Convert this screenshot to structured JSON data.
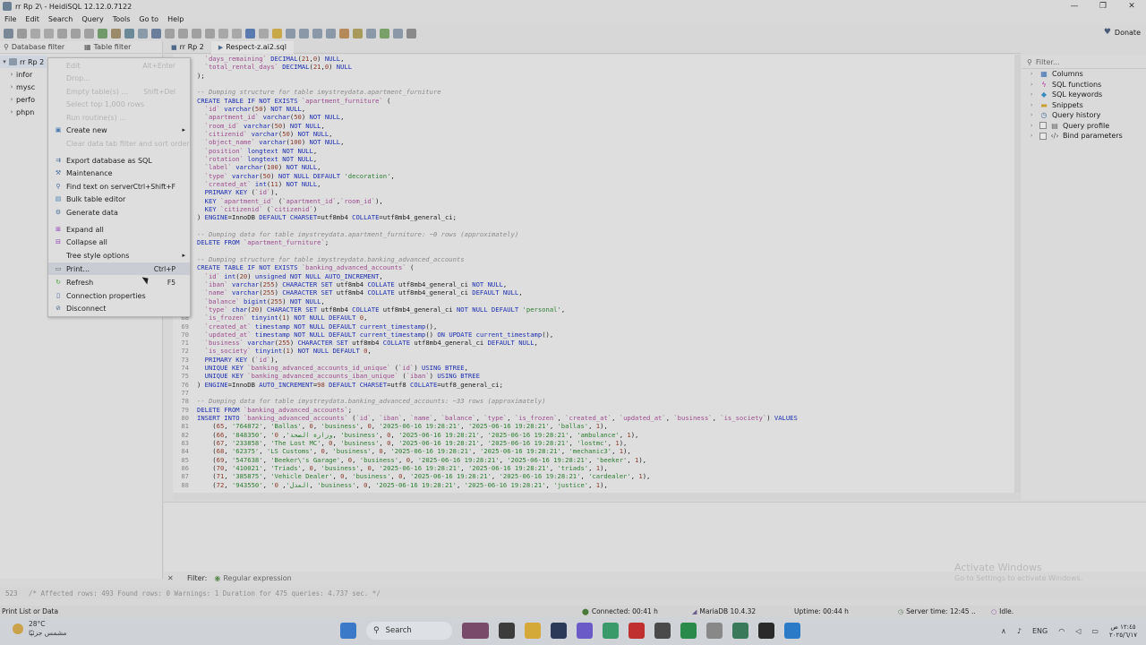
{
  "window": {
    "title": "rr Rp 2\\ - HeidiSQL 12.12.0.7122",
    "controls": [
      "—",
      "❐",
      "✕"
    ]
  },
  "menu": [
    "File",
    "Edit",
    "Search",
    "Query",
    "Tools",
    "Go to",
    "Help"
  ],
  "toolbar": {
    "donate": "Donate"
  },
  "left": {
    "database_filter": "Database filter",
    "table_filter": "Table filter",
    "tree": [
      {
        "label": "rr Rp 2",
        "root": true
      },
      {
        "label": "infor"
      },
      {
        "label": "mysc"
      },
      {
        "label": "perfo"
      },
      {
        "label": "phpn"
      }
    ]
  },
  "tabs": [
    {
      "label": "rr Rp 2"
    },
    {
      "label": "Respect-z.ai2.sql"
    }
  ],
  "context_menu": [
    {
      "label": "Edit",
      "shortcut": "Alt+Enter",
      "disabled": true
    },
    {
      "label": "Drop...",
      "shortcut": "",
      "disabled": true
    },
    {
      "label": "Empty table(s) ...",
      "shortcut": "Shift+Del",
      "disabled": true
    },
    {
      "label": "Select top 1,000 rows",
      "shortcut": "",
      "disabled": true
    },
    {
      "label": "Run routine(s) ...",
      "shortcut": "",
      "disabled": true
    },
    {
      "label": "Create new",
      "shortcut": "",
      "submenu": true
    },
    {
      "label": "Clear data tab filter and sort order",
      "shortcut": "",
      "disabled": true
    },
    {
      "label": "Export database as SQL",
      "shortcut": ""
    },
    {
      "label": "Maintenance",
      "shortcut": ""
    },
    {
      "label": "Find text on server",
      "shortcut": "Ctrl+Shift+F"
    },
    {
      "label": "Bulk table editor",
      "shortcut": ""
    },
    {
      "label": "Generate data",
      "shortcut": ""
    },
    {
      "label": "Expand all",
      "shortcut": ""
    },
    {
      "label": "Collapse all",
      "shortcut": ""
    },
    {
      "label": "Tree style options",
      "shortcut": "",
      "submenu": true
    },
    {
      "label": "Print...",
      "shortcut": "Ctrl+P",
      "hover": true
    },
    {
      "label": "Refresh",
      "shortcut": "F5"
    },
    {
      "label": "Connection properties",
      "shortcut": ""
    },
    {
      "label": "Disconnect",
      "shortcut": ""
    }
  ],
  "editor": {
    "lines": [
      {
        "n": "",
        "t": "  `days_remaining` DECIMAL(21,0) NULL,"
      },
      {
        "n": "",
        "t": "  `total_rental_days` DECIMAL(21,0) NULL"
      },
      {
        "n": "",
        "t": ");"
      },
      {
        "n": "",
        "t": ""
      },
      {
        "n": "",
        "t": "-- Dumping structure for table imystreydata.apartment_furniture"
      },
      {
        "n": "",
        "t": "CREATE TABLE IF NOT EXISTS `apartment_furniture` ("
      },
      {
        "n": "",
        "t": "  `id` varchar(50) NOT NULL,"
      },
      {
        "n": "",
        "t": "  `apartment_id` varchar(50) NOT NULL,"
      },
      {
        "n": "",
        "t": "  `room_id` varchar(50) NOT NULL,"
      },
      {
        "n": "",
        "t": "  `citizenid` varchar(50) NOT NULL,"
      },
      {
        "n": "",
        "t": "  `object_name` varchar(100) NOT NULL,"
      },
      {
        "n": "",
        "t": "  `position` longtext NOT NULL,"
      },
      {
        "n": "",
        "t": "  `rotation` longtext NOT NULL,"
      },
      {
        "n": "",
        "t": "  `label` varchar(100) NOT NULL,"
      },
      {
        "n": "",
        "t": "  `type` varchar(50) NOT NULL DEFAULT 'decoration',"
      },
      {
        "n": "",
        "t": "  `created_at` int(11) NOT NULL,"
      },
      {
        "n": "",
        "t": "  PRIMARY KEY (`id`),"
      },
      {
        "n": "",
        "t": "  KEY `apartment_id` (`apartment_id`,`room_id`),"
      },
      {
        "n": "",
        "t": "  KEY `citizenid` (`citizenid`)"
      },
      {
        "n": "",
        "t": ") ENGINE=InnoDB DEFAULT CHARSET=utf8mb4 COLLATE=utf8mb4_general_ci;"
      },
      {
        "n": "",
        "t": ""
      },
      {
        "n": "",
        "t": "-- Dumping data for table imystreydata.apartment_furniture: ~0 rows (approximately)"
      },
      {
        "n": "",
        "t": "DELETE FROM `apartment_furniture`;"
      },
      {
        "n": "",
        "t": ""
      },
      {
        "n": "",
        "t": "-- Dumping structure for table imystreydata.banking_advanced_accounts"
      },
      {
        "n": "",
        "t": "CREATE TABLE IF NOT EXISTS `banking_advanced_accounts` ("
      },
      {
        "n": "",
        "t": "  `id` int(20) unsigned NOT NULL AUTO_INCREMENT,"
      },
      {
        "n": "",
        "t": "  `iban` varchar(255) CHARACTER SET utf8mb4 COLLATE utf8mb4_general_ci NOT NULL,"
      },
      {
        "n": "",
        "t": "  `name` varchar(255) CHARACTER SET utf8mb4 COLLATE utf8mb4_general_ci DEFAULT NULL,"
      },
      {
        "n": "",
        "t": "  `balance` bigint(255) NOT NULL,"
      },
      {
        "n": "",
        "t": "  `type` char(20) CHARACTER SET utf8mb4 COLLATE utf8mb4_general_ci NOT NULL DEFAULT 'personal',"
      },
      {
        "n": "68",
        "t": "  `is_frozen` tinyint(1) NOT NULL DEFAULT 0,"
      },
      {
        "n": "69",
        "t": "  `created_at` timestamp NOT NULL DEFAULT current_timestamp(),"
      },
      {
        "n": "70",
        "t": "  `updated_at` timestamp NOT NULL DEFAULT current_timestamp() ON UPDATE current_timestamp(),"
      },
      {
        "n": "71",
        "t": "  `business` varchar(255) CHARACTER SET utf8mb4 COLLATE utf8mb4_general_ci DEFAULT NULL,"
      },
      {
        "n": "72",
        "t": "  `is_society` tinyint(1) NOT NULL DEFAULT 0,"
      },
      {
        "n": "73",
        "t": "  PRIMARY KEY (`id`),"
      },
      {
        "n": "74",
        "t": "  UNIQUE KEY `banking_advanced_accounts_id_unique` (`id`) USING BTREE,"
      },
      {
        "n": "75",
        "t": "  UNIQUE KEY `banking_advanced_accounts_iban_unique` (`iban`) USING BTREE"
      },
      {
        "n": "76",
        "t": ") ENGINE=InnoDB AUTO_INCREMENT=98 DEFAULT CHARSET=utf8 COLLATE=utf8_general_ci;"
      },
      {
        "n": "77",
        "t": ""
      },
      {
        "n": "78",
        "t": "-- Dumping data for table imystreydata.banking_advanced_accounts: ~33 rows (approximately)"
      },
      {
        "n": "79",
        "t": "DELETE FROM `banking_advanced_accounts`;"
      },
      {
        "n": "80",
        "t": "INSERT INTO `banking_advanced_accounts` (`id`, `iban`, `name`, `balance`, `type`, `is_frozen`, `created_at`, `updated_at`, `business`, `is_society`) VALUES"
      },
      {
        "n": "81",
        "t": "\t(65, '764872', 'Ballas', 0, 'business', 0, '2025-06-16 19:28:21', '2025-06-16 19:28:21', 'ballas', 1),"
      },
      {
        "n": "82",
        "t": "\t(66, '848350', 'وزارة الصحة', 0, 'business', 0, '2025-06-16 19:28:21', '2025-06-16 19:28:21', 'ambulance', 1),"
      },
      {
        "n": "83",
        "t": "\t(67, '233858', 'The Lost MC', 0, 'business', 0, '2025-06-16 19:28:21', '2025-06-16 19:28:21', 'lostmc', 1),"
      },
      {
        "n": "84",
        "t": "\t(68, '62375', 'LS Customs', 0, 'business', 0, '2025-06-16 19:28:21', '2025-06-16 19:28:21', 'mechanic3', 1),"
      },
      {
        "n": "85",
        "t": "\t(69, '547638', 'Beeker\\'s Garage', 0, 'business', 0, '2025-06-16 19:28:21', '2025-06-16 19:28:21', 'beeker', 1),"
      },
      {
        "n": "86",
        "t": "\t(70, '410021', 'Triads', 0, 'business', 0, '2025-06-16 19:28:21', '2025-06-16 19:28:21', 'triads', 1),"
      },
      {
        "n": "87",
        "t": "\t(71, '385875', 'Vehicle Dealer', 0, 'business', 0, '2025-06-16 19:28:21', '2025-06-16 19:28:21', 'cardealer', 1),"
      },
      {
        "n": "88",
        "t": "\t(72, '943550', 'العدل', 0, 'business', 0, '2025-06-16 19:28:21', '2025-06-16 19:28:21', 'justice', 1),"
      }
    ]
  },
  "right": {
    "filter_placeholder": "Filter...",
    "items": [
      {
        "label": "Columns",
        "icon": "columns-icon",
        "glyph": "▦",
        "color": "#3a6fb0"
      },
      {
        "label": "SQL functions",
        "icon": "function-icon",
        "glyph": "ϟ",
        "color": "#b03aa0"
      },
      {
        "label": "SQL keywords",
        "icon": "keyword-icon",
        "glyph": "◆",
        "color": "#3a8ac0"
      },
      {
        "label": "Snippets",
        "icon": "folder-icon",
        "glyph": "▬",
        "color": "#c9a030"
      },
      {
        "label": "Query history",
        "icon": "clock-icon",
        "glyph": "◷",
        "color": "#4a6a9a"
      },
      {
        "label": "Query profile",
        "icon": "profile-icon",
        "glyph": "▤",
        "color": "#666666",
        "checkbox": true
      },
      {
        "label": "Bind parameters",
        "icon": "code-icon",
        "glyph": "‹/›",
        "color": "#555555",
        "checkbox": true
      }
    ]
  },
  "filterbar": {
    "close": "✕",
    "label": "Filter:",
    "regex": "Regular expression"
  },
  "log": {
    "num": "523",
    "text": "/* Affected rows: 493  Found rows: 0  Warnings: 1  Duration for 475 queries: 4.737 sec. */"
  },
  "watermark": {
    "title": "Activate Windows",
    "sub": "Go to Settings to activate Windows."
  },
  "status": {
    "hint": "Print List or Data",
    "connected": "Connected: 00:41 h",
    "server": "MariaDB 10.4.32",
    "uptime": "Uptime: 00:44 h",
    "server_time": "Server time: 12:45 ..",
    "state": "Idle."
  },
  "taskbar": {
    "weather_temp": "28°C",
    "weather_desc": "مشمس جزئيًا",
    "search": "Search",
    "lang": "ENG",
    "time": "١٢:٤٥ ص",
    "date": "٢٠٢٥/٦/١٧"
  },
  "colors": {
    "keyword": "#1e2fb0",
    "comment": "#8b8b8b",
    "string": "#2e7d32",
    "identifier": "#9c4d8e",
    "number": "#8a3a2a"
  }
}
